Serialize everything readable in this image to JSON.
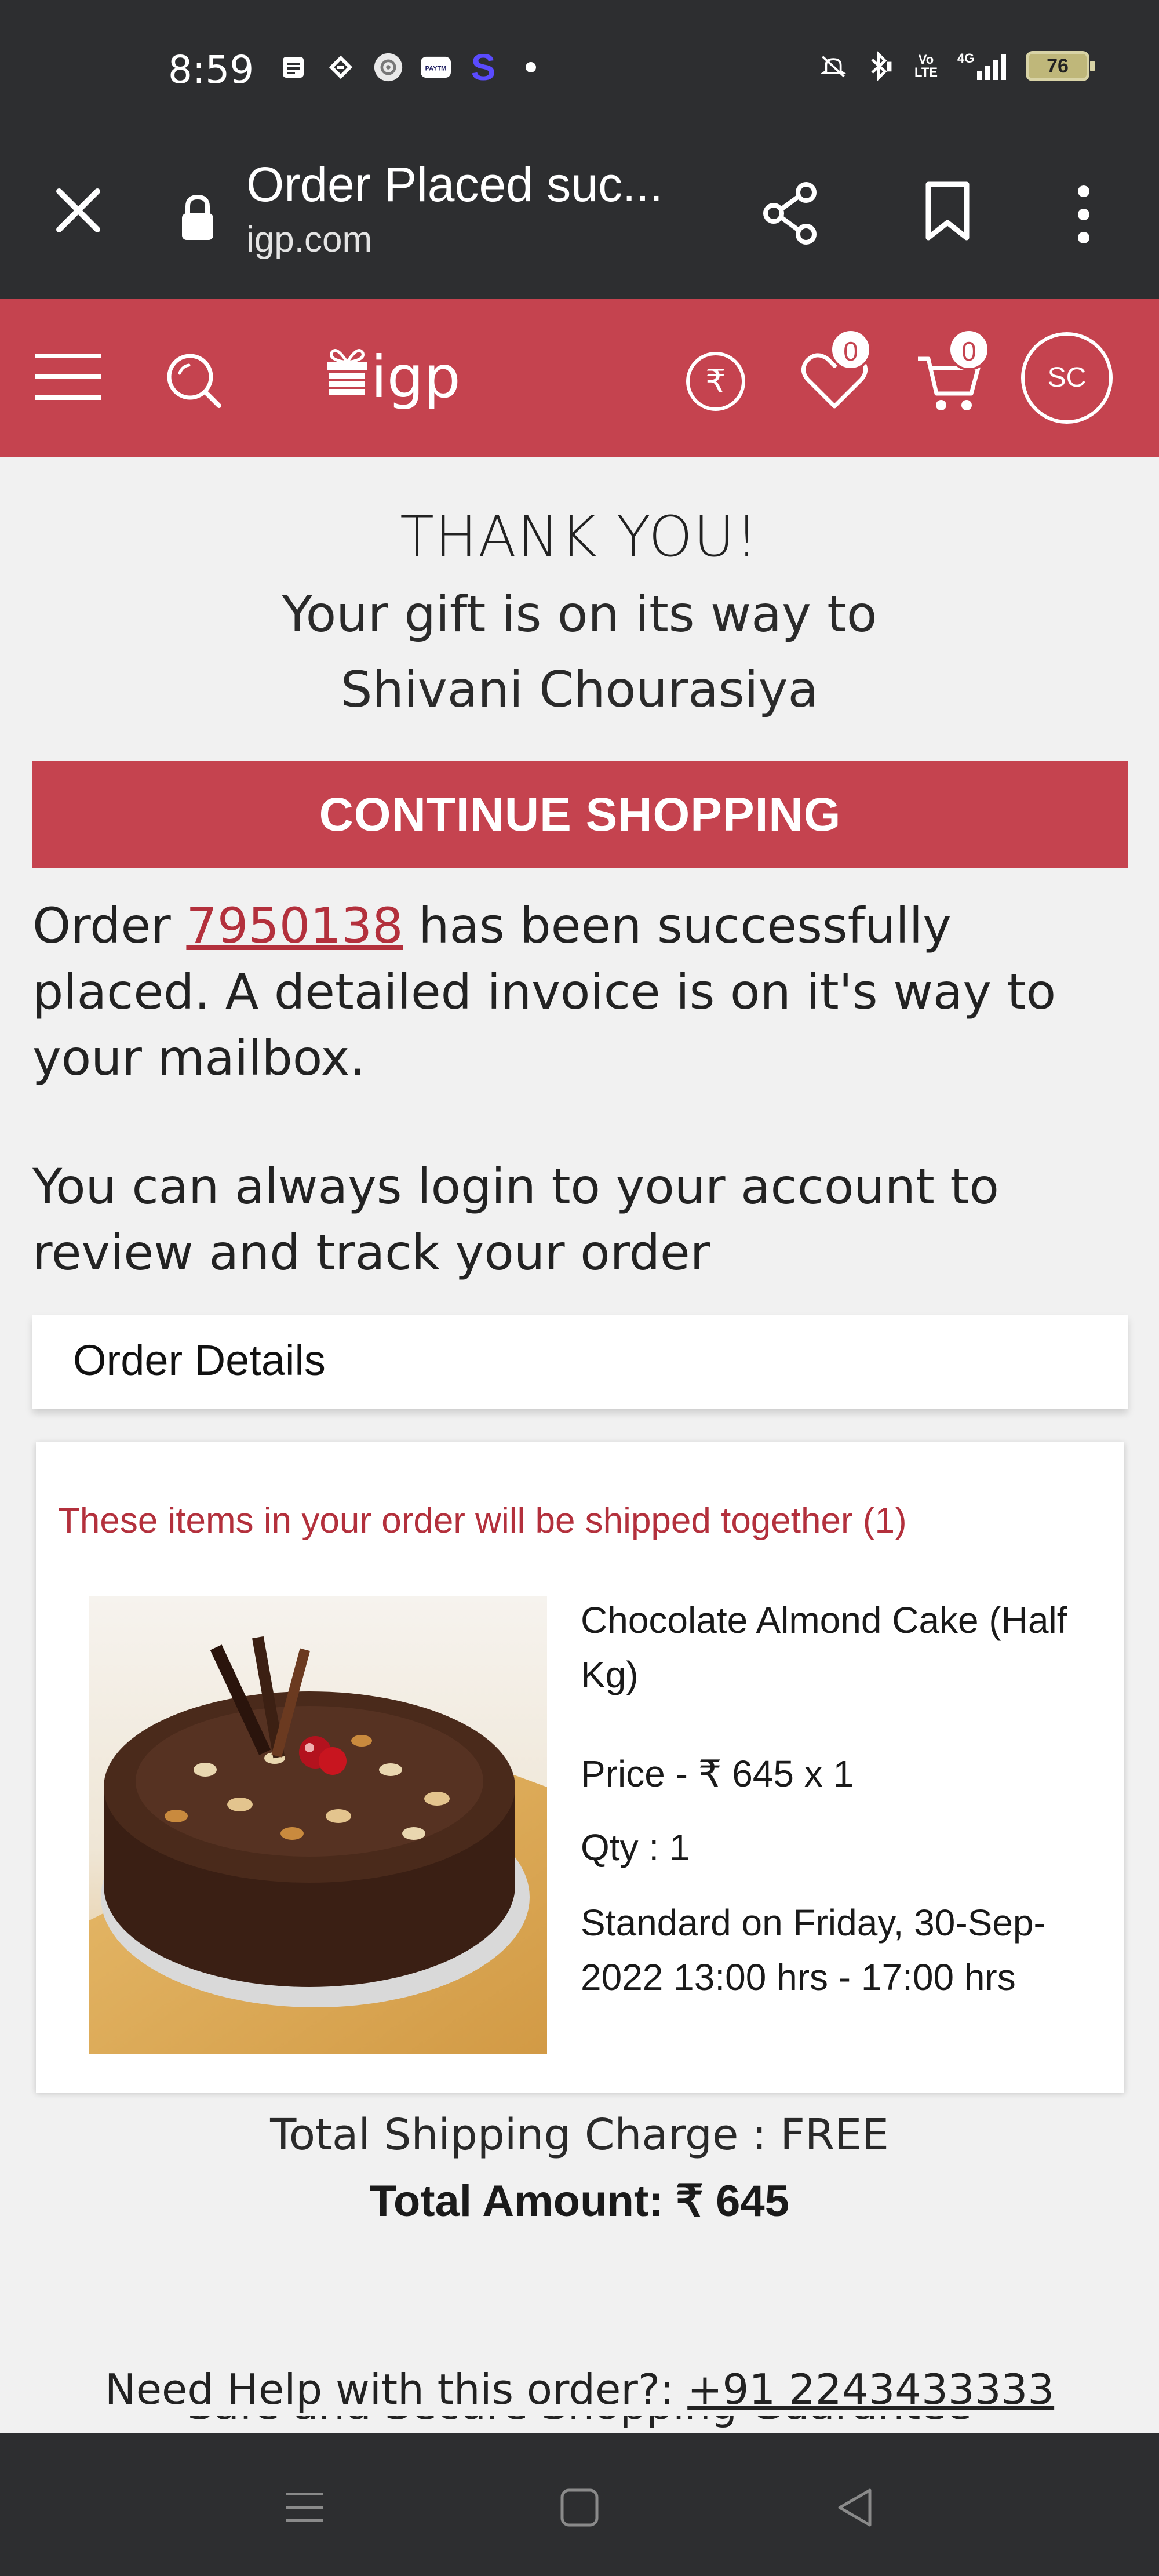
{
  "status_bar": {
    "time": "8:59",
    "battery": "76",
    "icons": [
      "notes-icon",
      "app-icon",
      "settings-icon",
      "paytm-icon",
      "s-icon",
      "dot",
      "mute-icon",
      "bluetooth-icon",
      "volte-icon",
      "4g-signal-icon",
      "battery-icon"
    ],
    "paytm_text": "PAYTM",
    "s_letter": "S",
    "volte_text": "Vo LTE",
    "network_text": "4G"
  },
  "browser": {
    "title": "Order Placed suc...",
    "url": "igp.com"
  },
  "site_header": {
    "logo_text": "igp",
    "wishlist_count": "0",
    "cart_count": "0",
    "avatar_initials": "SC",
    "currency_symbol": "₹",
    "brand_color": "#c5434f"
  },
  "confirmation": {
    "thanks": "THANK YOU!",
    "gift_line": "Your gift is on its way to",
    "recipient": "Shivani Chourasiya",
    "continue_label": "CONTINUE SHOPPING",
    "order_prefix": "Order ",
    "order_number": "7950138",
    "order_suffix": " has been successfully placed. A detailed invoice is on it's way to your mailbox.",
    "login_message": "You can always login to your account to review and track your order"
  },
  "order_details": {
    "header": "Order Details",
    "ship_note": "These items in your order will be shipped together (1)",
    "item": {
      "name": "Chocolate Almond Cake (Half Kg)",
      "price": "Price - ₹ 645 x 1",
      "qty": "Qty : 1",
      "delivery": "Standard on Friday, 30-Sep-2022 13:00 hrs - 17:00 hrs"
    },
    "shipping_charge": "Total Shipping Charge : FREE",
    "total_amount": "Total Amount:  ₹ 645"
  },
  "help": {
    "prefix": "Need Help with this order?: ",
    "phone": "+91 2243433333",
    "secure_text": "Safe and Secure Shopping Guarantee"
  }
}
